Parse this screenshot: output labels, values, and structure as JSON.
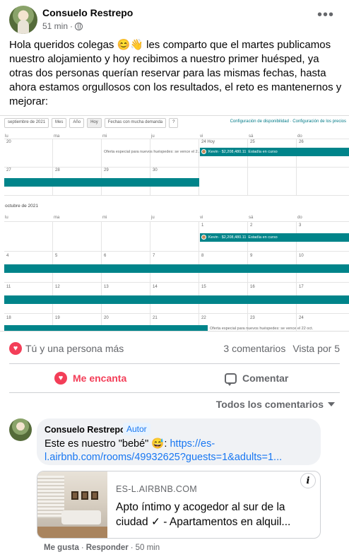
{
  "post": {
    "author": "Consuelo Restrepo",
    "time": "51 min",
    "separator": "·",
    "text": "Hola queridos colegas 😊👋 les comparto que el martes publicamos nuestro alojamiento y hoy recibimos a nuestro primer huésped, ya otras dos personas querían reservar para las mismas fechas, hasta ahora estamos orgullosos con los resultados, el reto es mantenernos y mejorar:"
  },
  "calendar": {
    "month_select": "septiembre de 2021",
    "btn_month": "Mes",
    "btn_year": "Año",
    "btn_today": "Hoy",
    "btn_demand": "Fechas con mucha demanda",
    "btn_help": "?",
    "config": "Configuración de disponibilidad · Configuración de los precios",
    "days": [
      "lu",
      "ma",
      "mi",
      "ju",
      "vi",
      "sá",
      "do"
    ],
    "sep_row1": [
      "20",
      "",
      "",
      "",
      "24 Hoy",
      "25",
      "26"
    ],
    "sep_row2": [
      "27",
      "28",
      "29",
      "30",
      "",
      "",
      ""
    ],
    "oct_title": "octubre de 2021",
    "oct_row1": [
      "",
      "",
      "",
      "",
      "1",
      "2",
      "3"
    ],
    "oct_row2": [
      "4",
      "5",
      "6",
      "7",
      "8",
      "9",
      "10"
    ],
    "oct_row3": [
      "11",
      "12",
      "13",
      "14",
      "15",
      "16",
      "17"
    ],
    "oct_row4": [
      "18",
      "19",
      "20",
      "21",
      "22",
      "23",
      "24"
    ],
    "guest_label": "Kevin · $2,208,480.11",
    "stay_label": "Estadía en curso",
    "offer1": "Oferta especial para nuevos huéspedes: se vence el 2...",
    "offer2": "Oferta especial para nuevos huéspedes: se vence el 22 oct."
  },
  "reactions": {
    "summary": "Tú y una persona más",
    "comments": "3 comentarios",
    "views": "Vista por 5"
  },
  "actions": {
    "love": "Me encanta",
    "comment": "Comentar"
  },
  "filter": "Todos los comentarios",
  "comment": {
    "author": "Consuelo Restrepo",
    "badge": "Autor",
    "text_before": "Este es nuestro \"bebé\" 😅: ",
    "link": "https://es-l.airbnb.com/rooms/49932625?guests=1&adults=1...",
    "like": "Me gusta",
    "reply": "Responder",
    "dot": "·",
    "time": "50 min"
  },
  "preview": {
    "domain": "ES-L.AIRBNB.COM",
    "title": "Apto íntimo y acogedor al sur de la ciudad ✓ - Apartamentos en alquil..."
  },
  "colors": {
    "teal": "#00848a",
    "love": "#f33e58",
    "link": "#1877f2"
  }
}
